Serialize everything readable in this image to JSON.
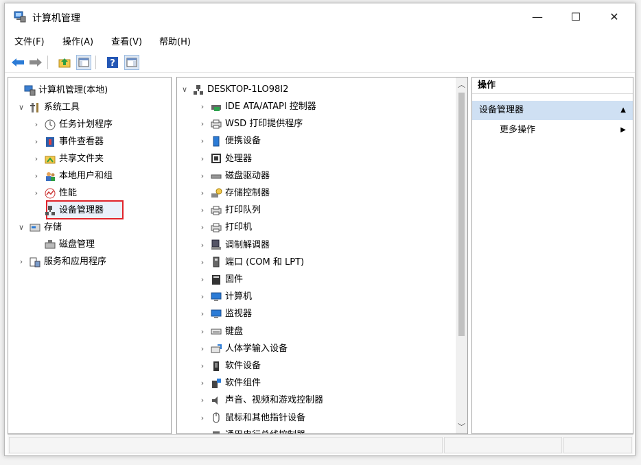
{
  "window": {
    "title": "计算机管理",
    "minimize": "—",
    "maximize": "☐",
    "close": "✕"
  },
  "menu": [
    "文件(F)",
    "操作(A)",
    "查看(V)",
    "帮助(H)"
  ],
  "toolbar": {
    "icons": [
      "back-arrow-icon",
      "forward-arrow-icon",
      "up-folder-icon",
      "show-hide-tree-icon",
      "help-icon",
      "properties-icon"
    ]
  },
  "left_tree": [
    {
      "label": "计算机管理(本地)",
      "arrow": "",
      "icon": "computer-management-icon",
      "indent": 0
    },
    {
      "label": "系统工具",
      "arrow": "∨",
      "icon": "system-tools-icon",
      "indent": 1
    },
    {
      "label": "任务计划程序",
      "arrow": "›",
      "icon": "clock-icon",
      "indent": 2
    },
    {
      "label": "事件查看器",
      "arrow": "›",
      "icon": "event-viewer-icon",
      "indent": 2
    },
    {
      "label": "共享文件夹",
      "arrow": "›",
      "icon": "shared-folder-icon",
      "indent": 2
    },
    {
      "label": "本地用户和组",
      "arrow": "›",
      "icon": "users-icon",
      "indent": 2
    },
    {
      "label": "性能",
      "arrow": "›",
      "icon": "performance-icon",
      "indent": 2
    },
    {
      "label": "设备管理器",
      "arrow": "",
      "icon": "device-manager-icon",
      "indent": 2
    },
    {
      "label": "存储",
      "arrow": "∨",
      "icon": "storage-icon",
      "indent": 1
    },
    {
      "label": "磁盘管理",
      "arrow": "",
      "icon": "disk-management-icon",
      "indent": 2
    },
    {
      "label": "服务和应用程序",
      "arrow": "›",
      "icon": "services-icon",
      "indent": 1
    }
  ],
  "device_tree": {
    "root": "DESKTOP-1LO98I2",
    "items": [
      {
        "label": "IDE ATA/ATAPI 控制器",
        "icon": "ide-controller-icon"
      },
      {
        "label": "WSD 打印提供程序",
        "icon": "printer-icon"
      },
      {
        "label": "便携设备",
        "icon": "portable-device-icon"
      },
      {
        "label": "处理器",
        "icon": "processor-icon"
      },
      {
        "label": "磁盘驱动器",
        "icon": "disk-drive-icon"
      },
      {
        "label": "存储控制器",
        "icon": "storage-controller-icon"
      },
      {
        "label": "打印队列",
        "icon": "printer-icon"
      },
      {
        "label": "打印机",
        "icon": "printer-icon"
      },
      {
        "label": "调制解调器",
        "icon": "modem-icon"
      },
      {
        "label": "端口 (COM 和 LPT)",
        "icon": "port-icon"
      },
      {
        "label": "固件",
        "icon": "firmware-icon"
      },
      {
        "label": "计算机",
        "icon": "monitor-icon"
      },
      {
        "label": "监视器",
        "icon": "monitor-icon"
      },
      {
        "label": "键盘",
        "icon": "keyboard-icon"
      },
      {
        "label": "人体学输入设备",
        "icon": "hid-icon"
      },
      {
        "label": "软件设备",
        "icon": "software-device-icon"
      },
      {
        "label": "软件组件",
        "icon": "software-component-icon"
      },
      {
        "label": "声音、视频和游戏控制器",
        "icon": "speaker-icon"
      },
      {
        "label": "鼠标和其他指针设备",
        "icon": "mouse-icon"
      },
      {
        "label": "通用串行总线控制器",
        "icon": "usb-icon"
      }
    ]
  },
  "actions": {
    "header": "操作",
    "group": "设备管理器",
    "more": "更多操作"
  },
  "colors": {
    "selection_border": "#e0232a",
    "actions_group_bg": "#cfe0f3",
    "icon_blue": "#2b7bd6"
  }
}
